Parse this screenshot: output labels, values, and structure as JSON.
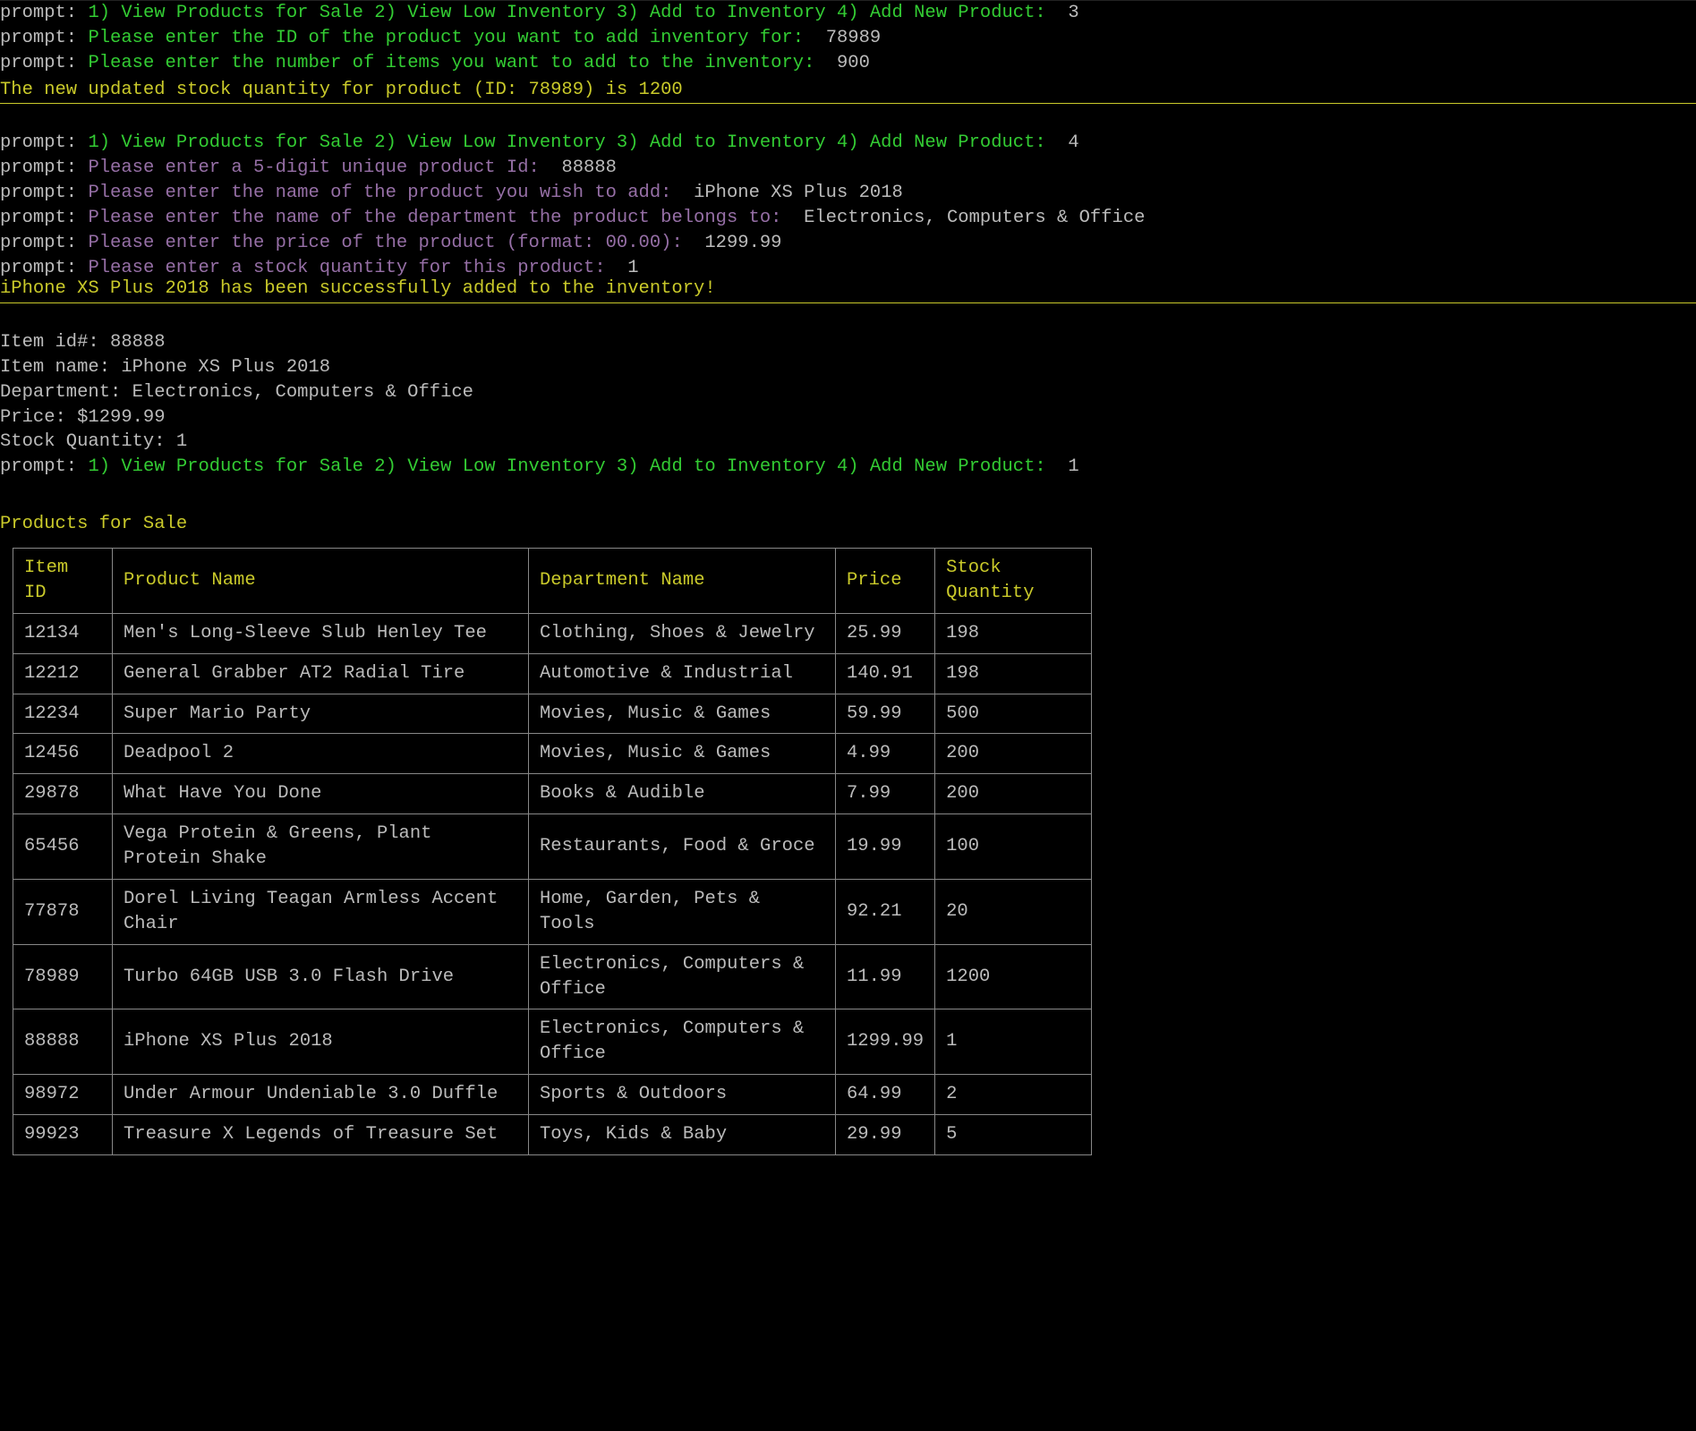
{
  "prompt_label": "prompt:",
  "section1": {
    "menu_text": "1) View Products for Sale 2) View Low Inventory 3) Add to Inventory 4) Add New Product:",
    "menu_choice": "3",
    "id_prompt": "Please enter the ID of the product you want to add inventory for:",
    "id_value": "78989",
    "qty_prompt": "Please enter the number of items you want to add to the inventory:",
    "qty_value": "900",
    "status": "The new updated stock quantity for product (ID: 78989) is 1200"
  },
  "section2": {
    "menu_text": "1) View Products for Sale 2) View Low Inventory 3) Add to Inventory 4) Add New Product:",
    "menu_choice": "4",
    "pid_prompt": "Please enter a 5-digit unique product Id:",
    "pid_value": "88888",
    "name_prompt": "Please enter the name of the product you wish to add:",
    "name_value": "iPhone XS Plus 2018",
    "dept_prompt": "Please enter the name of the department the product belongs to:",
    "dept_value": "Electronics, Computers & Office",
    "price_prompt": "Please enter the price of the product (format: 00.00):",
    "price_value": "1299.99",
    "stock_prompt": "Please enter a stock quantity for this product:",
    "stock_value": "1",
    "status": "iPhone XS Plus 2018 has been successfully added to the inventory!"
  },
  "detail": {
    "l1": "Item id#: 88888",
    "l2": "Item name: iPhone XS Plus 2018",
    "l3": "Department: Electronics, Computers & Office",
    "l4": "Price: $1299.99",
    "l5": "Stock Quantity: 1"
  },
  "section3": {
    "menu_text": "1) View Products for Sale 2) View Low Inventory 3) Add to Inventory 4) Add New Product:",
    "menu_choice": "1"
  },
  "products_title": "Products for Sale",
  "table": {
    "headers": {
      "id": "Item ID",
      "name": "Product Name",
      "dept": "Department Name",
      "price": "Price",
      "qty": "Stock Quantity"
    },
    "rows": [
      {
        "id": "12134",
        "name": "Men's Long-Sleeve Slub Henley Tee",
        "dept": "Clothing, Shoes & Jewelry",
        "price": "25.99",
        "qty": "198"
      },
      {
        "id": "12212",
        "name": "General Grabber AT2 Radial Tire",
        "dept": "Automotive & Industrial",
        "price": "140.91",
        "qty": "198"
      },
      {
        "id": "12234",
        "name": "Super Mario Party",
        "dept": "Movies, Music & Games",
        "price": "59.99",
        "qty": "500"
      },
      {
        "id": "12456",
        "name": "Deadpool 2",
        "dept": "Movies, Music & Games",
        "price": "4.99",
        "qty": "200"
      },
      {
        "id": "29878",
        "name": "What Have You Done",
        "dept": "Books & Audible",
        "price": "7.99",
        "qty": "200"
      },
      {
        "id": "65456",
        "name": "Vega Protein & Greens, Plant Protein Shake",
        "dept": "Restaurants, Food & Groce",
        "price": "19.99",
        "qty": "100"
      },
      {
        "id": "77878",
        "name": "Dorel Living Teagan Armless Accent Chair",
        "dept": "Home, Garden, Pets & Tools",
        "price": "92.21",
        "qty": "20"
      },
      {
        "id": "78989",
        "name": "Turbo 64GB USB 3.0 Flash Drive",
        "dept": "Electronics, Computers & Office",
        "price": "11.99",
        "qty": "1200"
      },
      {
        "id": "88888",
        "name": "iPhone XS Plus 2018",
        "dept": "Electronics, Computers & Office",
        "price": "1299.99",
        "qty": "1"
      },
      {
        "id": "98972",
        "name": "Under Armour Undeniable 3.0 Duffle",
        "dept": "Sports & Outdoors",
        "price": "64.99",
        "qty": "2"
      },
      {
        "id": "99923",
        "name": "Treasure X Legends of Treasure Set",
        "dept": "Toys, Kids & Baby",
        "price": "29.99",
        "qty": "5"
      }
    ]
  }
}
